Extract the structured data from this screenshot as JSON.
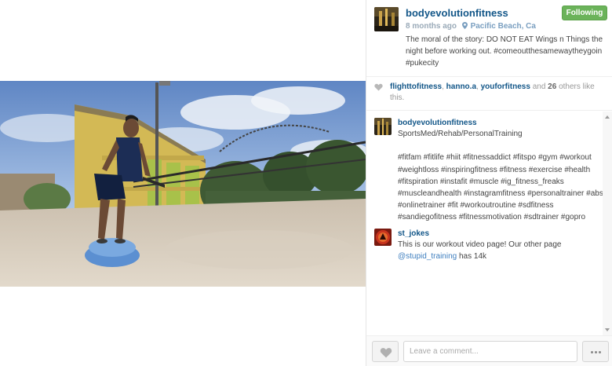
{
  "post": {
    "username": "bodyevolutionfitness",
    "follow_label": "Following",
    "time_ago": "8 months ago",
    "location": "Pacific Beach, Ca",
    "caption": "The moral of the story: DO NOT EAT Wings n Things the night before working out. #comeoutthesamewaytheygoin #pukecity"
  },
  "likes": {
    "likers": [
      "flighttofitness",
      "hanno.a",
      "youforfitness"
    ],
    "separator": ", ",
    "and_text": " and ",
    "others_count": "26",
    "others_suffix": " others like this."
  },
  "comments": [
    {
      "user": "bodyevolutionfitness",
      "text": "SportsMed/Rehab/PersonalTraining\n\n#fitfam #fitlife #hiit #fitnessaddict #fitspo #gym #workout #weightloss #inspiringfitness #fitness #exercise #health #fitspiration #instafit #muscle #ig_fitness_freaks #muscleandhealth #instagramfitness #personaltrainer #abs #onlinetrainer #fit #workoutroutine #sdfitness #sandiegofitness #fitnessmotivation #sdtrainer #gopro"
    },
    {
      "user": "st_jokes",
      "text_before": "This is our workout video page! Our other page ",
      "mention": "@stupid_training",
      "text_after": " has 14k"
    }
  ],
  "footer": {
    "comment_placeholder": "Leave a comment..."
  },
  "colors": {
    "username": "#125688",
    "follow_bg": "#6bb35a",
    "link": "#3f7fbf"
  },
  "icons": [
    "heart-icon",
    "location-pin-icon",
    "more-options-icon",
    "scroll-up-icon",
    "scroll-down-icon"
  ]
}
